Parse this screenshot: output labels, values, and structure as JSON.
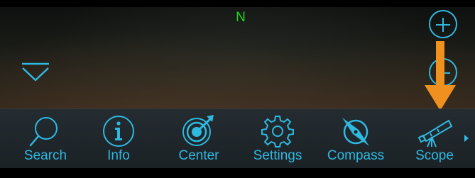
{
  "compass": {
    "heading": "N"
  },
  "zoom": {
    "in_icon": "plus-icon",
    "out_icon": "minus-icon"
  },
  "toolbar": {
    "items": [
      {
        "label": "Search",
        "icon": "magnifier-icon"
      },
      {
        "label": "Info",
        "icon": "info-icon"
      },
      {
        "label": "Center",
        "icon": "target-icon"
      },
      {
        "label": "Settings",
        "icon": "gear-icon"
      },
      {
        "label": "Compass",
        "icon": "compass-icon"
      },
      {
        "label": "Scope",
        "icon": "telescope-icon"
      }
    ],
    "more_icon": "chevron-right-icon"
  },
  "colors": {
    "accent": "#2fb8e0",
    "compass": "#1fd41f",
    "callout": "#f0901e"
  }
}
